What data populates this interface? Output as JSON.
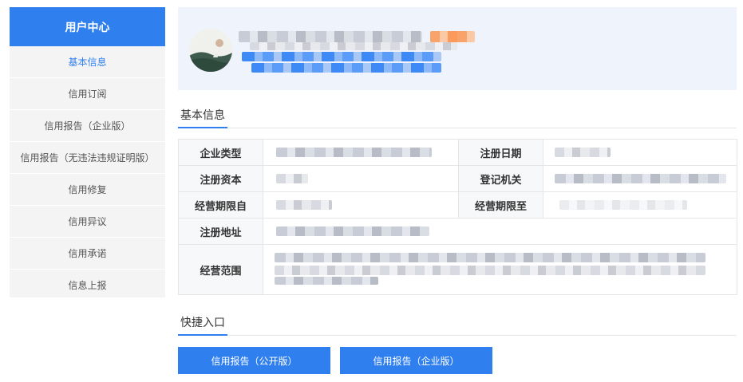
{
  "sidebar": {
    "title": "用户中心",
    "items": [
      {
        "label": "基本信息",
        "active": true
      },
      {
        "label": "信用订阅"
      },
      {
        "label": "信用报告（企业版）"
      },
      {
        "label": "信用报告（无违法违规证明版）"
      },
      {
        "label": "信用修复"
      },
      {
        "label": "信用异议"
      },
      {
        "label": "信用承诺"
      },
      {
        "label": "信息上报"
      }
    ]
  },
  "basic_info": {
    "title": "基本信息",
    "labels": {
      "company_type": "企业类型",
      "register_date": "注册日期",
      "register_capital": "注册资本",
      "authority": "登记机关",
      "period_from": "经营期限自",
      "period_to": "经营期限至",
      "address": "注册地址",
      "scope": "经营范围"
    }
  },
  "quick_access": {
    "title": "快捷入口",
    "buttons": [
      "信用报告（公开版）",
      "信用报告（企业版）"
    ]
  },
  "colors": {
    "accent": "#2f7fef",
    "banner_bg": "#eef3fc",
    "sidebar_bg": "#f4f4f4",
    "label_bg": "#f7f8fa"
  }
}
